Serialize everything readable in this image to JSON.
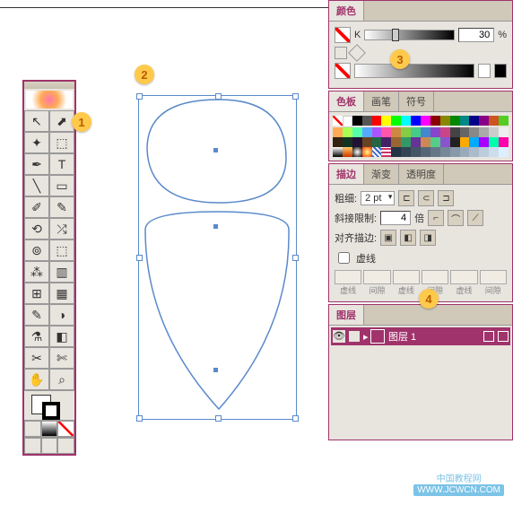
{
  "badges": {
    "b1": "1",
    "b2": "2",
    "b3": "3",
    "b4": "4"
  },
  "color": {
    "tab": "颜色",
    "ch": "K",
    "val": "30",
    "pct": "%"
  },
  "swatch": {
    "t1": "色板",
    "t2": "画笔",
    "t3": "符号"
  },
  "stroke": {
    "t1": "描边",
    "t2": "渐变",
    "t3": "透明度",
    "weight_lbl": "粗细:",
    "weight": "2 pt",
    "miter_lbl": "斜接限制:",
    "miter": "4",
    "miter_unit": "倍",
    "align_lbl": "对齐描边:",
    "dash_chk": "虚线",
    "d1": "虚线",
    "d2": "间隙",
    "d3": "虚线",
    "d4": "间隙",
    "d5": "虚线",
    "d6": "间隙"
  },
  "layer": {
    "tab": "图层",
    "name": "图层 1"
  },
  "watermark": {
    "l1": "中国教程网",
    "l2": "WWW.JCWCN.COM"
  },
  "tools": [
    "↖",
    "⬈",
    "✦",
    "⬚",
    "✒",
    "T",
    "╱",
    "▭",
    "✎",
    "↻",
    "⟲",
    "▦",
    "⊞",
    "▂",
    "✂",
    "⬓",
    "◐",
    "⟳",
    "✎",
    "◢",
    "⚗",
    "◧",
    "〰",
    "⫴",
    "☡",
    "✋",
    "⊡",
    "⌕"
  ]
}
